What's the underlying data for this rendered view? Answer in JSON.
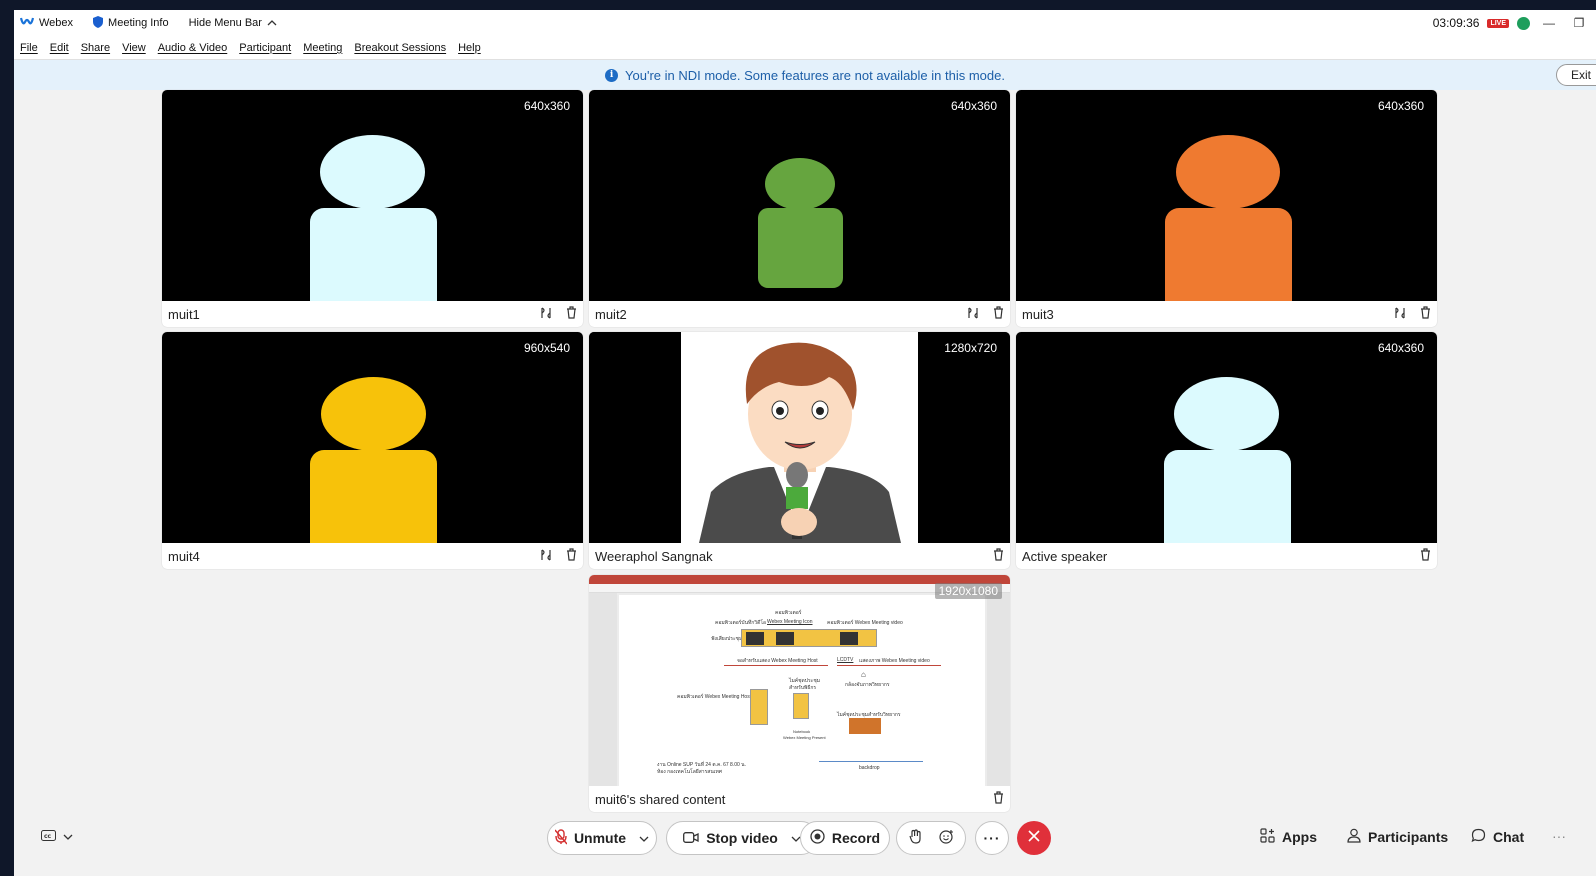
{
  "titlebar": {
    "app_name": "Webex",
    "meeting_info": "Meeting Info",
    "hide_menu_bar": "Hide Menu Bar",
    "clock": "03:09:36",
    "live_badge": "LIVE"
  },
  "menu": [
    "File",
    "Edit",
    "Share",
    "View",
    "Audio & Video",
    "Participant",
    "Meeting",
    "Breakout Sessions",
    "Help"
  ],
  "banner": {
    "message": "You're in NDI mode. Some features are not available in this mode.",
    "exit_label": "Exit"
  },
  "tiles": [
    {
      "name": "muit1",
      "resolution": "640x360",
      "avatar_color": "#dcfafe"
    },
    {
      "name": "muit2",
      "resolution": "640x360",
      "avatar_color": "#66a53f"
    },
    {
      "name": "muit3",
      "resolution": "640x360",
      "avatar_color": "#ef7a30"
    },
    {
      "name": "muit4",
      "resolution": "960x540",
      "avatar_color": "#f7c20a"
    },
    {
      "name": "Weeraphol Sangnak",
      "resolution": "1280x720"
    },
    {
      "name": "Active speaker",
      "resolution": "640x360",
      "avatar_color": "#dcfafe"
    },
    {
      "name": "muit6's shared content",
      "resolution": "1920x1080"
    }
  ],
  "shared_slide": {
    "top_label": "คอมพิวเตอร์",
    "row_label_1": "คอมพิวเตอร์บันทึกวิดีโอ",
    "row_label_2": "Webex Meeting Icon",
    "row_label_3": "คอมพิวเตอร์ Webex Meeting video",
    "left_label": "ฟังเสียงประชุม",
    "mid_label_1": "จอสำหรับแสดง Webex Meeting Host",
    "mid_label_2": "LCDTV",
    "mid_label_3": "แสดงภาพ Webex Meeting video",
    "camera_label": "กล้องจับภาพวิทยากร",
    "host_label": "คอมพิวเตอร์ Webex Meeting Host",
    "mic_label_1": "ไมค์ชุดประชุม",
    "mic_label_2": "สำหรับพิธีกร",
    "mic_label_3": "ไมค์ชุดประชุมสำหรับวิทยากร",
    "notebook_label": "Notebook",
    "notebook_label_2": "Webex Meeting Present",
    "footer_1": "งาน Online SUP วันที่ 24 ต.ค. 67 8.00 น.",
    "footer_2": "ห้อง กองเทคโนโลยีสารสนเทศ",
    "backdrop_label": "backdrop"
  },
  "controls": {
    "unmute": "Unmute",
    "stop_video": "Stop video",
    "record": "Record",
    "apps": "Apps",
    "participants": "Participants",
    "chat": "Chat"
  },
  "icons": {
    "webex_logo": "webex-logo-icon",
    "meeting_info": "shield-icon",
    "chevron_up": "chevron-up-icon",
    "info": "info-icon",
    "pin": "pin-icon",
    "trash": "trash-icon",
    "captions": "captions-icon",
    "mic_muted": "mic-off-icon",
    "camera": "camera-icon",
    "record": "record-icon",
    "raise_hand": "hand-icon",
    "reactions": "emoji-icon",
    "more": "more-icon",
    "end_call": "close-icon",
    "apps": "apps-icon",
    "participants": "person-icon",
    "chat": "chat-icon"
  },
  "colors": {
    "banner_bg": "#e4f1fb",
    "banner_text": "#1d5fa8",
    "end_call": "#e0303a",
    "live": "#d92b2b"
  }
}
